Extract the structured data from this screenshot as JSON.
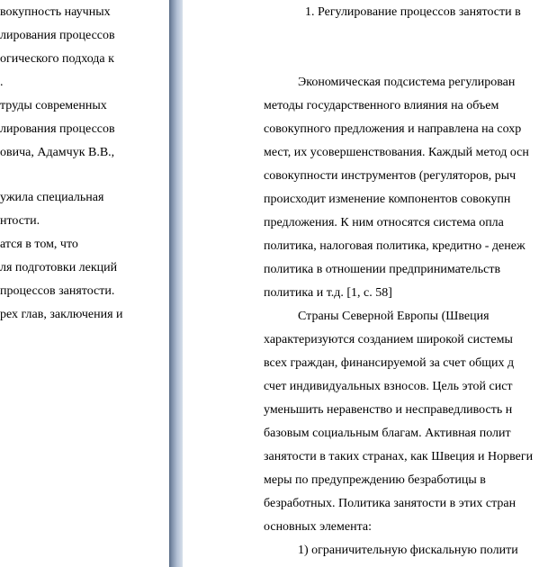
{
  "left_page": {
    "lines": [
      "вокупность научных",
      "лирования процессов",
      "огического подхода к",
      ".",
      "труды современных",
      "лирования процессов",
      "овича,  Адамчук В.В.,",
      "",
      "ужила   специальная",
      "нтости.",
      "атся    в    том,    что",
      "ля подготовки лекций",
      "процессов занятости.",
      "рех глав, заключения и"
    ]
  },
  "right_page": {
    "heading": "1. Регулирование процессов занятости в",
    "lines": [
      "Экономическая  подсистема  регулирован",
      "методы  государственного  влияния  на  объем",
      "совокупного предложения и направлена на сохр",
      "мест, их усовершенствования. Каждый метод осн",
      "совокупности  инструментов  (регуляторов,  рыч",
      "происходит  изменение  компонентов  совокупн",
      "предложения.  К  ним  относятся  система  опла",
      "политика, налоговая политика, кредитно - денеж",
      "политика   в   отношении   предпринимательств",
      "политика и т.д. [1, с. 58]",
      "Страны    Северной    Европы    (Швеция",
      "характеризуются созданием широкой системы",
      "всех граждан, финансируемой за счет общих д",
      "счет  индивидуальных  взносов.  Цель  этой  сист",
      "уменьшить неравенство и несправедливость н",
      "базовым  социальным  благам.  Активная  полит",
      "занятости в таких странах, как Швеция и Норвеги",
      "меры   по   предупреждению   безработицы   в",
      "безработных.  Политика  занятости  в  этих  стран",
      "основных элемента:",
      "1)  ограничительную  фискальную  полити"
    ]
  }
}
